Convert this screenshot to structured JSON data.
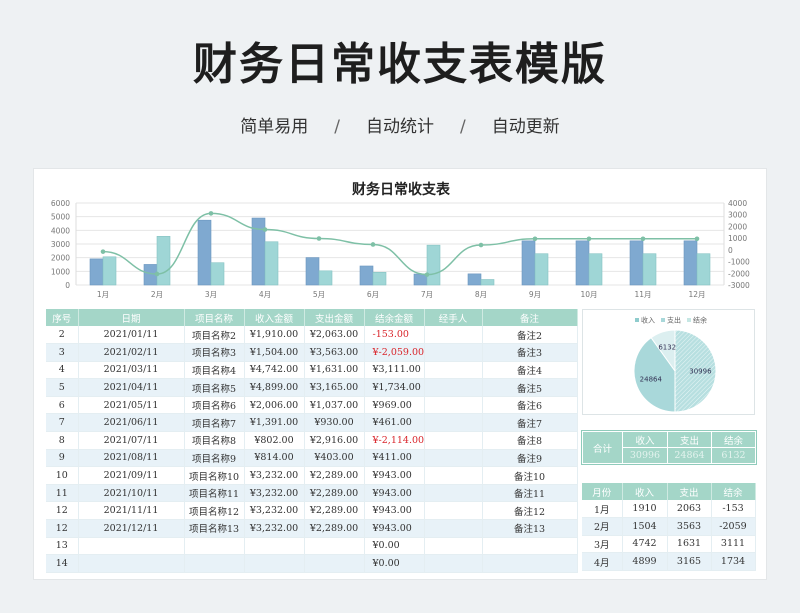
{
  "hero": {
    "title": "财务日常收支表模版",
    "tags": [
      "简单易用",
      "自动统计",
      "自动更新"
    ],
    "separator": "/"
  },
  "sheet": {
    "chart_title": "财务日常收支表",
    "table_headers": [
      "序号",
      "日期",
      "项目名称",
      "收入金额",
      "支出金额",
      "结余金额",
      "经手人",
      "备注"
    ],
    "rows": [
      {
        "no": "2",
        "date": "2021/01/11",
        "name": "项目名称2",
        "income": "¥1,910.00",
        "expense": "¥2,063.00",
        "balance": "-153.00",
        "handler": "",
        "note": "备注2",
        "neg": true
      },
      {
        "no": "3",
        "date": "2021/02/11",
        "name": "项目名称3",
        "income": "¥1,504.00",
        "expense": "¥3,563.00",
        "balance": "¥-2,059.00",
        "handler": "",
        "note": "备注3",
        "neg": true
      },
      {
        "no": "4",
        "date": "2021/03/11",
        "name": "项目名称4",
        "income": "¥4,742.00",
        "expense": "¥1,631.00",
        "balance": "¥3,111.00",
        "handler": "",
        "note": "备注4",
        "neg": false
      },
      {
        "no": "5",
        "date": "2021/04/11",
        "name": "项目名称5",
        "income": "¥4,899.00",
        "expense": "¥3,165.00",
        "balance": "¥1,734.00",
        "handler": "",
        "note": "备注5",
        "neg": false
      },
      {
        "no": "6",
        "date": "2021/05/11",
        "name": "项目名称6",
        "income": "¥2,006.00",
        "expense": "¥1,037.00",
        "balance": "¥969.00",
        "handler": "",
        "note": "备注6",
        "neg": false
      },
      {
        "no": "7",
        "date": "2021/06/11",
        "name": "项目名称7",
        "income": "¥1,391.00",
        "expense": "¥930.00",
        "balance": "¥461.00",
        "handler": "",
        "note": "备注7",
        "neg": false
      },
      {
        "no": "8",
        "date": "2021/07/11",
        "name": "项目名称8",
        "income": "¥802.00",
        "expense": "¥2,916.00",
        "balance": "¥-2,114.00",
        "handler": "",
        "note": "备注8",
        "neg": true
      },
      {
        "no": "9",
        "date": "2021/08/11",
        "name": "项目名称9",
        "income": "¥814.00",
        "expense": "¥403.00",
        "balance": "¥411.00",
        "handler": "",
        "note": "备注9",
        "neg": false
      },
      {
        "no": "10",
        "date": "2021/09/11",
        "name": "项目名称10",
        "income": "¥3,232.00",
        "expense": "¥2,289.00",
        "balance": "¥943.00",
        "handler": "",
        "note": "备注10",
        "neg": false
      },
      {
        "no": "11",
        "date": "2021/10/11",
        "name": "项目名称11",
        "income": "¥3,232.00",
        "expense": "¥2,289.00",
        "balance": "¥943.00",
        "handler": "",
        "note": "备注11",
        "neg": false
      },
      {
        "no": "12",
        "date": "2021/11/11",
        "name": "项目名称12",
        "income": "¥3,232.00",
        "expense": "¥2,289.00",
        "balance": "¥943.00",
        "handler": "",
        "note": "备注12",
        "neg": false
      },
      {
        "no": "12",
        "date": "2021/12/11",
        "name": "项目名称13",
        "income": "¥3,232.00",
        "expense": "¥2,289.00",
        "balance": "¥943.00",
        "handler": "",
        "note": "备注13",
        "neg": false
      },
      {
        "no": "13",
        "date": "",
        "name": "",
        "income": "",
        "expense": "",
        "balance": "¥0.00",
        "handler": "",
        "note": "",
        "neg": false
      },
      {
        "no": "14",
        "date": "",
        "name": "",
        "income": "",
        "expense": "",
        "balance": "¥0.00",
        "handler": "",
        "note": "",
        "neg": false
      }
    ],
    "summary": {
      "label": "合计",
      "headers": [
        "收入",
        "支出",
        "结余"
      ],
      "values": [
        "30996",
        "24864",
        "6132"
      ]
    },
    "monthly": {
      "headers": [
        "月份",
        "收入",
        "支出",
        "结余"
      ],
      "rows": [
        [
          "1月",
          "1910",
          "2063",
          "-153"
        ],
        [
          "2月",
          "1504",
          "3563",
          "-2059"
        ],
        [
          "3月",
          "4742",
          "1631",
          "3111"
        ],
        [
          "4月",
          "4899",
          "3165",
          "1734"
        ]
      ]
    }
  },
  "colors": {
    "income_bar": "#7fa9d0",
    "expense_bar": "#9fd6d6",
    "balance_line": "#7ec0a6",
    "header_bg": "#a4d6c8",
    "alt_row": "#e8f2f8",
    "negative": "#d9262c"
  },
  "chart_data": [
    {
      "type": "bar",
      "categories": [
        "1月",
        "2月",
        "3月",
        "4月",
        "5月",
        "6月",
        "7月",
        "8月",
        "9月",
        "10月",
        "11月",
        "12月"
      ],
      "series": [
        {
          "values": [
            1910,
            1504,
            4742,
            4899,
            2006,
            1391,
            802,
            814,
            3232,
            3232,
            3232,
            3232
          ]
        },
        {
          "values": [
            2063,
            3563,
            1631,
            3165,
            1037,
            930,
            2916,
            403,
            2289,
            2289,
            2289,
            2289
          ]
        },
        {
          "values": [
            -153,
            -2059,
            3111,
            1734,
            969,
            461,
            -2114,
            411,
            943,
            943,
            943,
            943
          ]
        }
      ],
      "y_left_ticks": [
        0,
        1000,
        2000,
        3000,
        4000,
        5000,
        6000
      ],
      "y_right_ticks": [
        -3000,
        -2000,
        -1000,
        0,
        1000,
        2000,
        3000,
        4000
      ],
      "ylim": [
        0,
        6000
      ],
      "ylim_right": [
        -3000,
        4000
      ],
      "grid": true
    },
    {
      "type": "pie",
      "labels": [
        "收入",
        "支出",
        "结余"
      ],
      "values": [
        30996,
        24864,
        6132
      ],
      "legend": "top"
    }
  ]
}
